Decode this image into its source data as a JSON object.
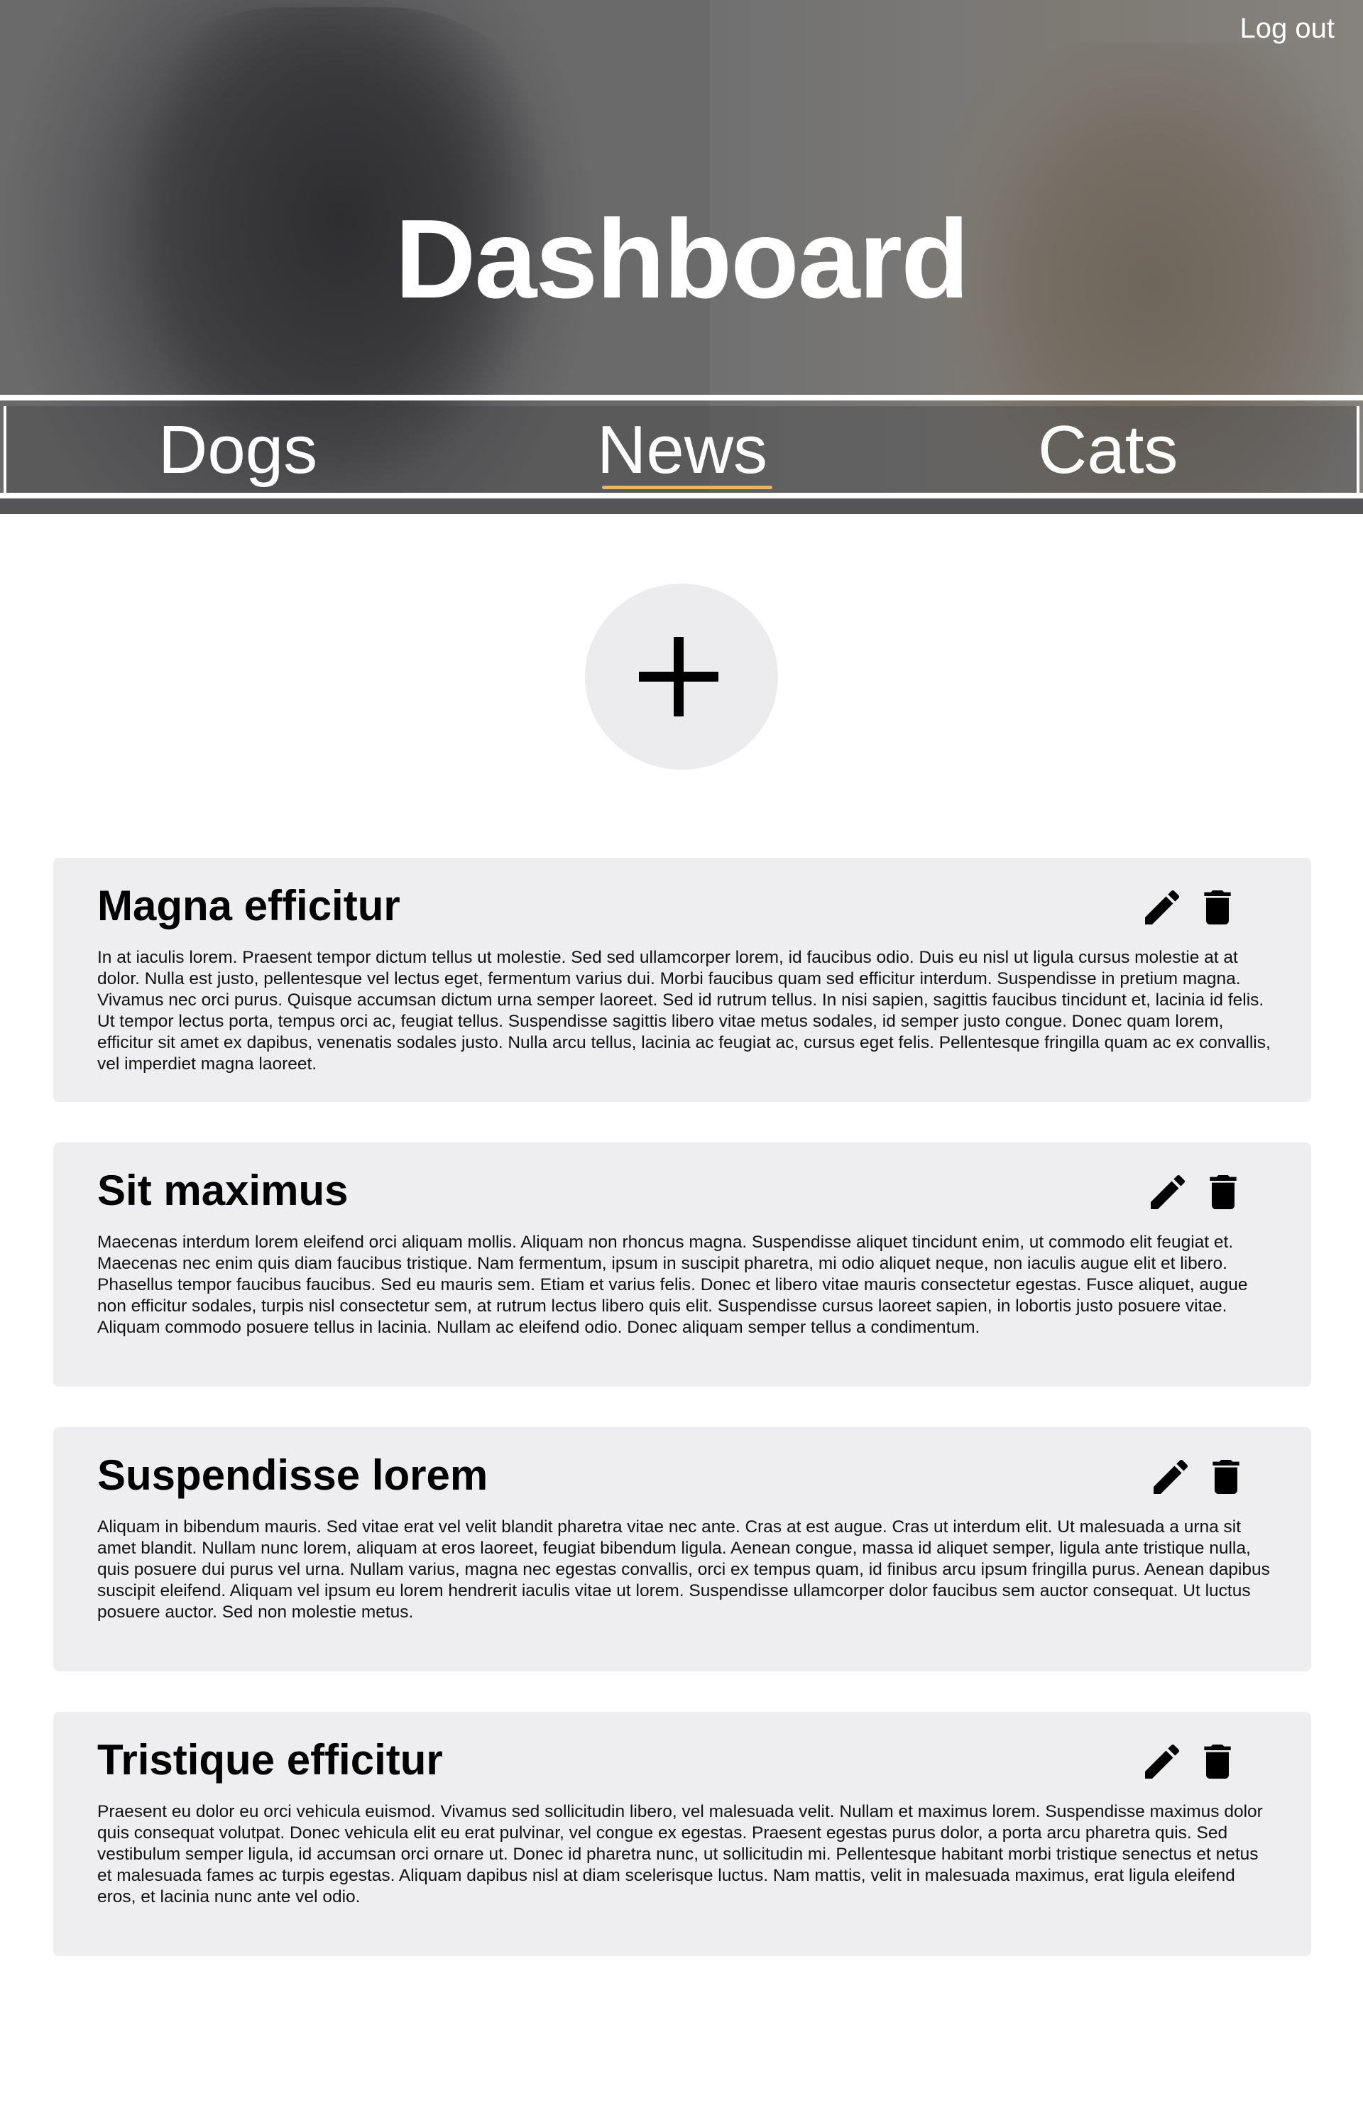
{
  "header": {
    "logout_label": "Log out",
    "title": "Dashboard"
  },
  "nav": {
    "items": [
      {
        "label": "Dogs",
        "active": false
      },
      {
        "label": "News",
        "active": true
      },
      {
        "label": "Cats",
        "active": false
      }
    ],
    "active_underline_color": "#e8b36b"
  },
  "add_button": {
    "icon": "plus-icon"
  },
  "posts": [
    {
      "title": "Magna efficitur",
      "body": "In at iaculis lorem. Praesent tempor dictum tellus ut molestie. Sed sed ullamcorper lorem, id faucibus odio. Duis eu nisl ut ligula cursus molestie at at dolor. Nulla est justo, pellentesque vel lectus eget, fermentum varius dui. Morbi faucibus quam sed efficitur interdum. Suspendisse in pretium magna. Vivamus nec orci purus. Quisque accumsan dictum urna semper laoreet. Sed id rutrum tellus. In nisi sapien, sagittis faucibus tincidunt et, lacinia id felis. Ut tempor lectus porta, tempus orci ac, feugiat tellus. Suspendisse sagittis libero vitae metus sodales, id semper justo congue. Donec quam lorem, efficitur sit amet ex dapibus, venenatis sodales justo. Nulla arcu tellus, lacinia ac feugiat ac, cursus eget felis. Pellentesque fringilla quam ac ex convallis, vel imperdiet magna laoreet.",
      "edit_icon": "pencil-icon",
      "delete_icon": "trash-icon"
    },
    {
      "title": "Sit maximus",
      "body": "Maecenas interdum lorem eleifend orci aliquam mollis. Aliquam non rhoncus magna. Suspendisse aliquet tincidunt enim, ut commodo elit feugiat et. Maecenas nec enim quis diam faucibus tristique. Nam fermentum, ipsum in suscipit pharetra, mi odio aliquet neque, non iaculis augue elit et libero. Phasellus tempor faucibus faucibus. Sed eu mauris sem. Etiam et varius felis. Donec et libero vitae mauris consectetur egestas. Fusce aliquet, augue non efficitur sodales, turpis nisl consectetur sem, at rutrum lectus libero quis elit. Suspendisse cursus laoreet sapien, in lobortis justo posuere vitae. Aliquam commodo posuere tellus in lacinia. Nullam ac eleifend odio. Donec aliquam semper tellus a condimentum.",
      "edit_icon": "pencil-icon",
      "delete_icon": "trash-icon"
    },
    {
      "title": "Suspendisse lorem",
      "body": "Aliquam in bibendum mauris. Sed vitae erat vel velit blandit pharetra vitae nec ante. Cras at est augue. Cras ut interdum elit. Ut malesuada a urna sit amet blandit. Nullam nunc lorem, aliquam at eros laoreet, feugiat bibendum ligula. Aenean congue, massa id aliquet semper, ligula ante tristique nulla, quis posuere dui purus vel urna. Nullam varius, magna nec egestas convallis, orci ex tempus quam, id finibus arcu ipsum fringilla purus. Aenean dapibus suscipit eleifend. Aliquam vel ipsum eu lorem hendrerit iaculis vitae ut lorem. Suspendisse ullamcorper dolor faucibus sem auctor consequat. Ut luctus posuere auctor. Sed non molestie metus.",
      "edit_icon": "pencil-icon",
      "delete_icon": "trash-icon"
    },
    {
      "title": "Tristique efficitur",
      "body": "Praesent eu dolor eu orci vehicula euismod. Vivamus sed sollicitudin libero, vel malesuada velit. Nullam et maximus lorem. Suspendisse maximus dolor quis consequat volutpat. Donec vehicula elit eu erat pulvinar, vel congue ex egestas. Praesent egestas purus dolor, a porta arcu pharetra quis. Sed vestibulum semper ligula, id accumsan orci ornare ut. Donec id pharetra nunc, ut sollicitudin mi. Pellentesque habitant morbi tristique senectus et netus et malesuada fames ac turpis egestas. Aliquam dapibus nisl at diam scelerisque luctus. Nam mattis, velit in malesuada maximus, erat ligula eleifend eros, et lacinia nunc ante vel odio.",
      "edit_icon": "pencil-icon",
      "delete_icon": "trash-icon"
    }
  ]
}
